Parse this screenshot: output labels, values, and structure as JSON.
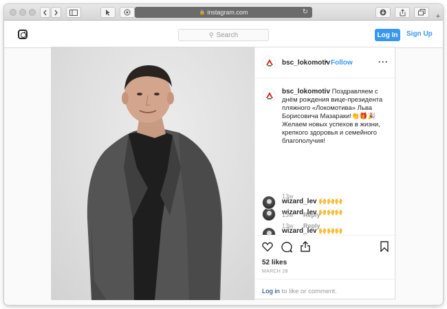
{
  "browser": {
    "url": "instagram.com"
  },
  "nav": {
    "search_placeholder": "Search",
    "login_label": "Log In",
    "signup_label": "Sign Up"
  },
  "post": {
    "username": "bsc_lokomotiv",
    "follow_label": "Follow",
    "caption": "Поздравляем с днём рождения вице-президента пляжного «Локомотива» Льва Борисовича Мазараки!👏🎁🎉 Желаем новых успехов в жизни, крепкого здоровья и семейного благополучия!",
    "caption_time": "13w",
    "comments": [
      {
        "username": "wizard_lev",
        "text": "🙌🙌🙌",
        "time": "13w",
        "reply": "Reply"
      },
      {
        "username": "wizard_lev",
        "text": "🙌🙌🙌",
        "time": "13w",
        "reply": "Reply"
      },
      {
        "username": "wizard_lev",
        "text": "🙌🙌🙌",
        "time": "",
        "reply": ""
      }
    ],
    "likes": "52 likes",
    "date": "MARCH 28",
    "login_link": "Log in",
    "login_suffix": " to like or comment."
  }
}
